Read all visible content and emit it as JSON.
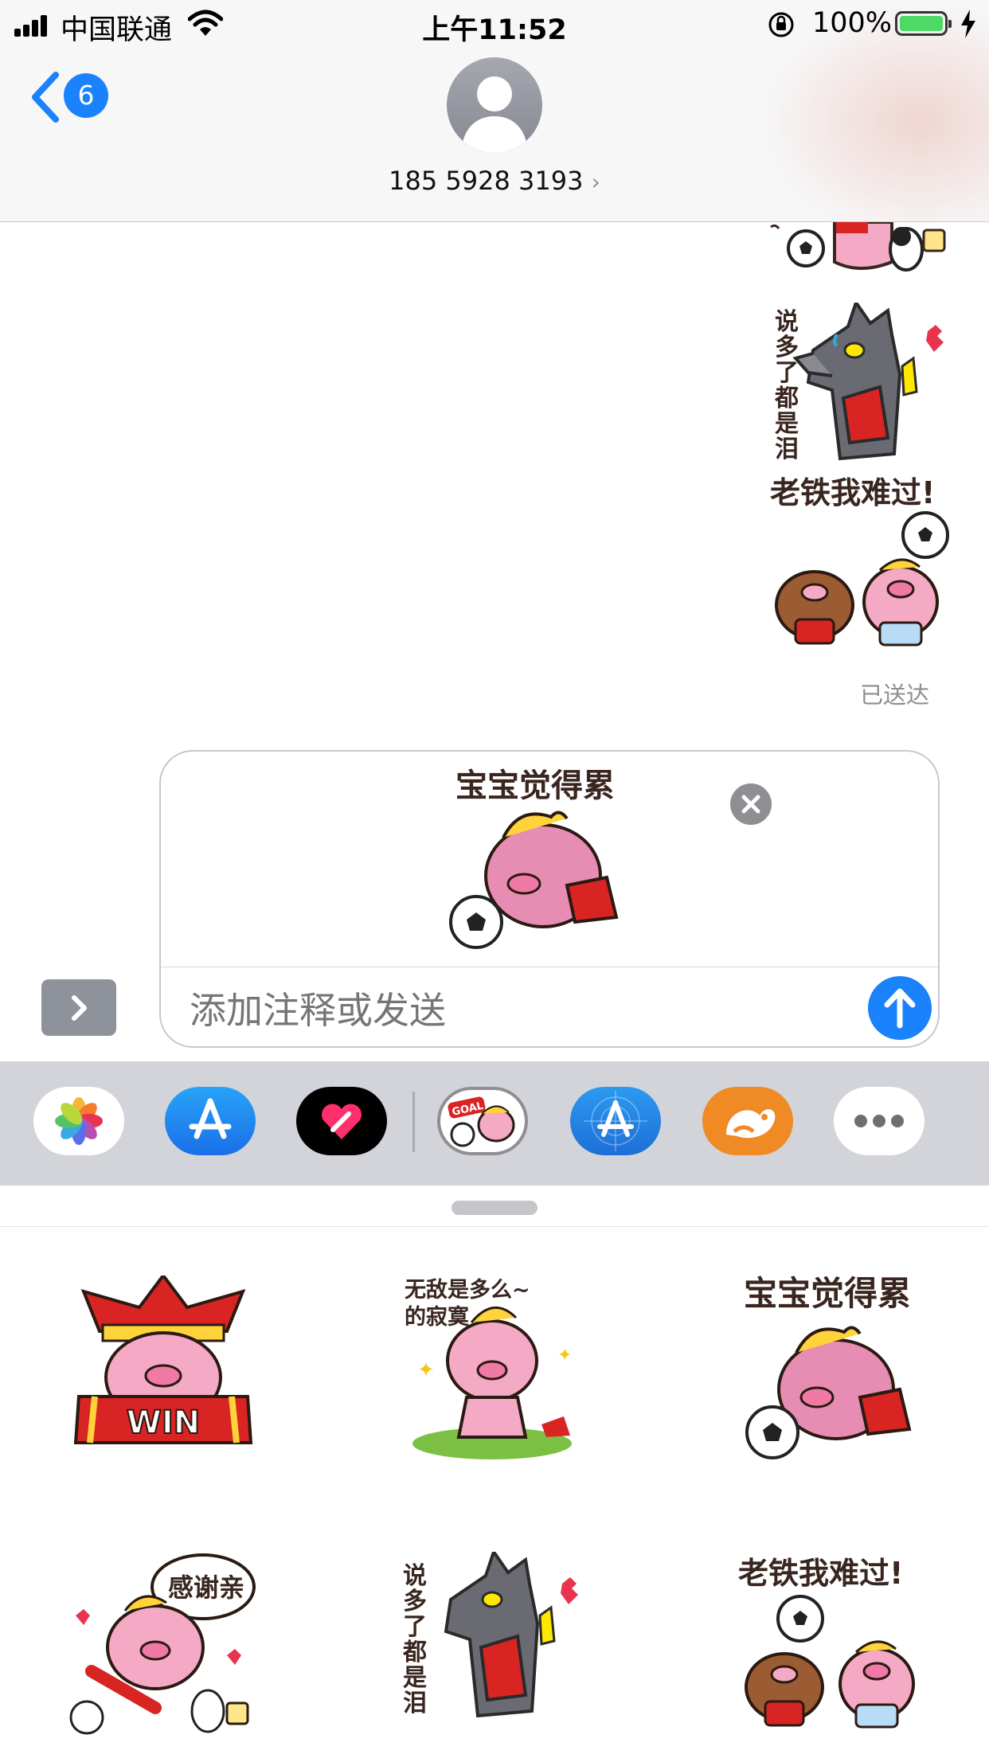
{
  "status_bar": {
    "carrier": "中国联通",
    "time": "上午11:52",
    "battery_percent": "100%"
  },
  "nav": {
    "back_badge": "6",
    "contact_number": "185 5928 3193",
    "contact_chevron": "›"
  },
  "conversation": {
    "stickers": [
      {
        "icon": "soccer-sticker-partial"
      },
      {
        "icon": "wolf-crying-sticker",
        "caption": "说多了都是泪"
      },
      {
        "icon": "pigs-sad-sticker",
        "caption": "老铁我难过!"
      }
    ],
    "delivered_label": "已送达"
  },
  "compose": {
    "attached_sticker_caption": "宝宝觉得累",
    "placeholder": "添加注释或发送"
  },
  "app_drawer": {
    "apps": [
      {
        "name": "photos-app-icon"
      },
      {
        "name": "app-store-icon"
      },
      {
        "name": "digital-touch-icon"
      },
      {
        "name": "goal-sticker-pack-icon",
        "label": "GOAL"
      },
      {
        "name": "app-store-browser-icon"
      },
      {
        "name": "uc-browser-icon"
      },
      {
        "name": "more-apps-icon"
      }
    ],
    "colors": {
      "accent": "#1a82fb",
      "drawer_bg": "#d2d4da",
      "uc_orange": "#f08a24"
    }
  },
  "sticker_panel": {
    "stickers": [
      {
        "name": "win-scarf-pig",
        "text": "WIN"
      },
      {
        "name": "invincible-lonely-pig",
        "text": "无敌是多么~的寂寞"
      },
      {
        "name": "tired-baby-pig",
        "text": "宝宝觉得累"
      },
      {
        "name": "thanks-guitar-pig",
        "text": "感谢亲"
      },
      {
        "name": "crying-wolf",
        "text": "说多了都是泪"
      },
      {
        "name": "sad-pigs",
        "text": "老铁我难过!"
      }
    ]
  }
}
